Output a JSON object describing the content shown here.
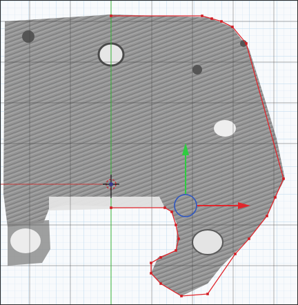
{
  "app": {
    "view_name": "3D viewport"
  },
  "scene": {
    "reference_image": {
      "kind": "scanned sketch on graph paper",
      "paper_color": "#f8fafc",
      "paper_grid_color": "#bcd8ee",
      "sketch_ink_color": "#7c7c7c",
      "sketch_dark_color": "#565656",
      "hole_color": "#dcdcdc"
    },
    "viewport_grid": {
      "line_color": "#3a3a3a",
      "x_axis_color": "#c53a3a",
      "y_axis_color": "#33b033"
    },
    "outline": {
      "color": "#e0262c",
      "vertex_color": "#d11d24",
      "state": "edit mode, all vertices selected"
    },
    "object_origin": {
      "color": "#3a3a8c",
      "ring_color": "#c8303a"
    },
    "gizmo": {
      "type": "translate",
      "x_arrow_color": "#e0262c",
      "y_arrow_color": "#2ecc40",
      "circle_color": "#2d56c2"
    }
  }
}
